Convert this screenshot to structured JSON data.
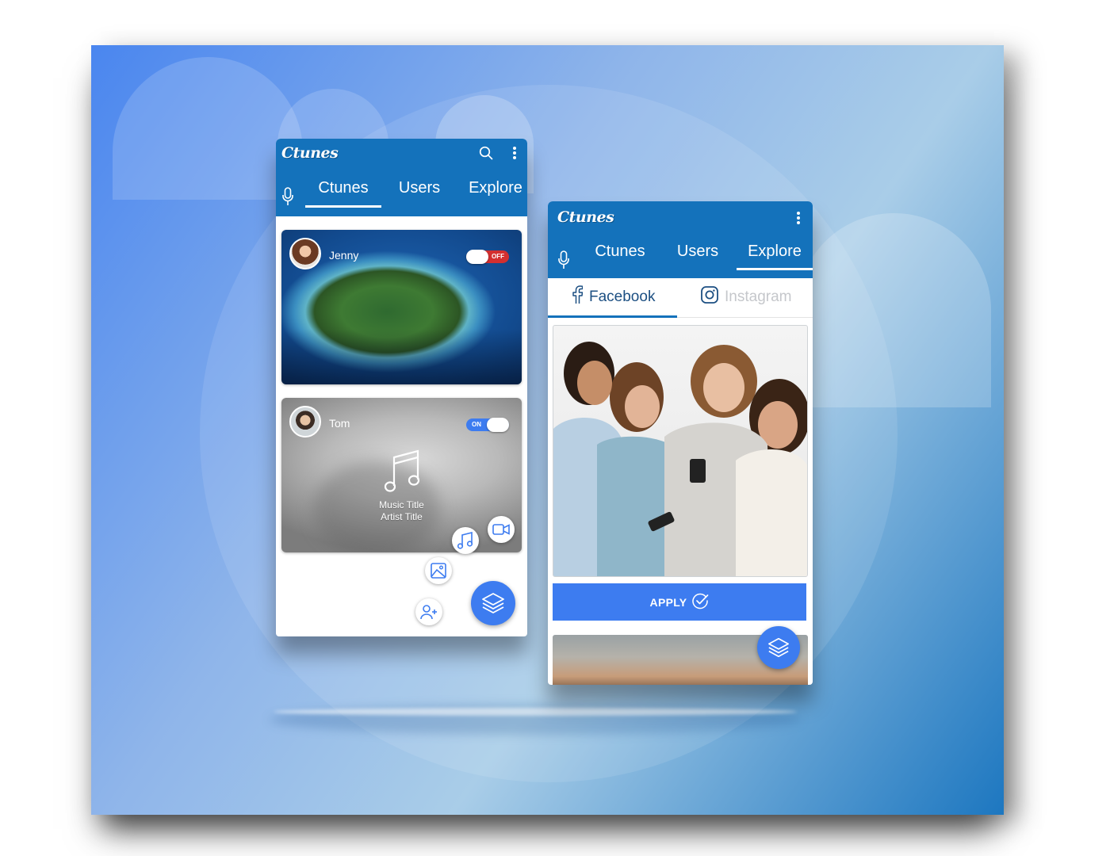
{
  "phone_left": {
    "brand": "Ctunes",
    "tabs": [
      "Ctunes",
      "Users",
      "Explore"
    ],
    "active_tab": "Ctunes",
    "cards": [
      {
        "user": "Jenny",
        "toggle": "OFF"
      },
      {
        "user": "Tom",
        "toggle": "ON",
        "music_title": "Music Title",
        "artist_title": "Artist Title"
      }
    ],
    "icons": [
      "search-icon",
      "more-vert-icon",
      "mic-icon",
      "music-note-icon",
      "video-icon",
      "image-icon",
      "add-user-icon",
      "layers-icon"
    ]
  },
  "phone_right": {
    "brand": "Ctunes",
    "tabs": [
      "Ctunes",
      "Users",
      "Explore"
    ],
    "active_tab": "Explore",
    "subtabs": [
      "Facebook",
      "Instagram"
    ],
    "active_subtab": "Facebook",
    "apply_label": "APPLY",
    "icons": [
      "more-vert-icon",
      "mic-icon",
      "facebook-icon",
      "instagram-icon",
      "check-circle-icon",
      "layers-icon"
    ]
  },
  "colors": {
    "appbar": "#1472bb",
    "accent": "#3d7cf0",
    "toggle_off": "#d32f2f",
    "toggle_on": "#3d7cf0",
    "inactive_subtab": "#c5c7cb"
  }
}
